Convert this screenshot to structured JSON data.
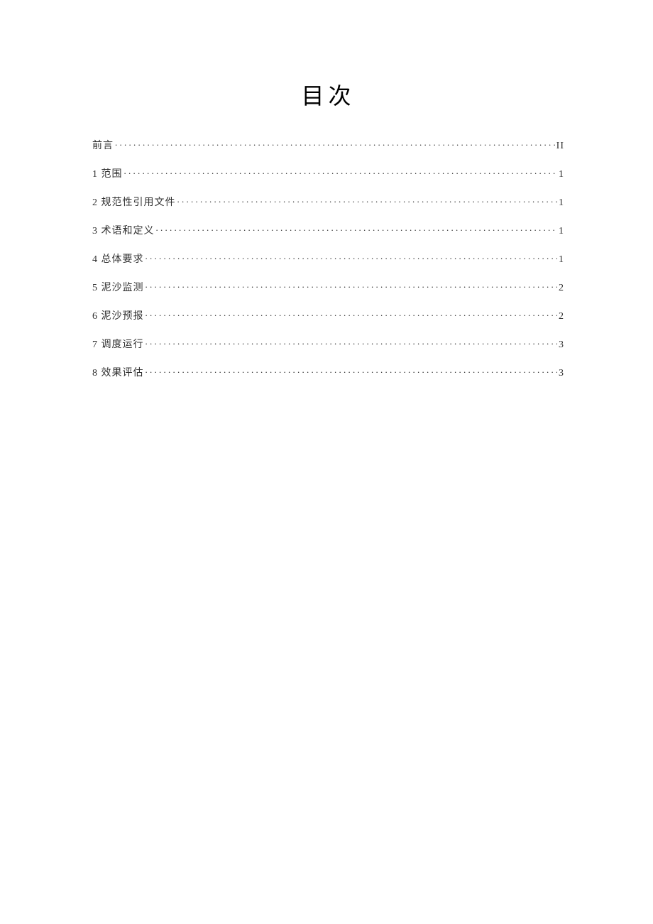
{
  "title": "目次",
  "toc": [
    {
      "label": "前言",
      "page": "II"
    },
    {
      "label": "1 范围",
      "page": "1"
    },
    {
      "label": "2 规范性引用文件",
      "page": "1"
    },
    {
      "label": "3 术语和定义",
      "page": "1"
    },
    {
      "label": "4 总体要求",
      "page": "1"
    },
    {
      "label": "5 泥沙监测",
      "page": "2"
    },
    {
      "label": "6 泥沙预报",
      "page": "2"
    },
    {
      "label": "7 调度运行",
      "page": "3"
    },
    {
      "label": "8   效果评估",
      "page": "3"
    }
  ]
}
